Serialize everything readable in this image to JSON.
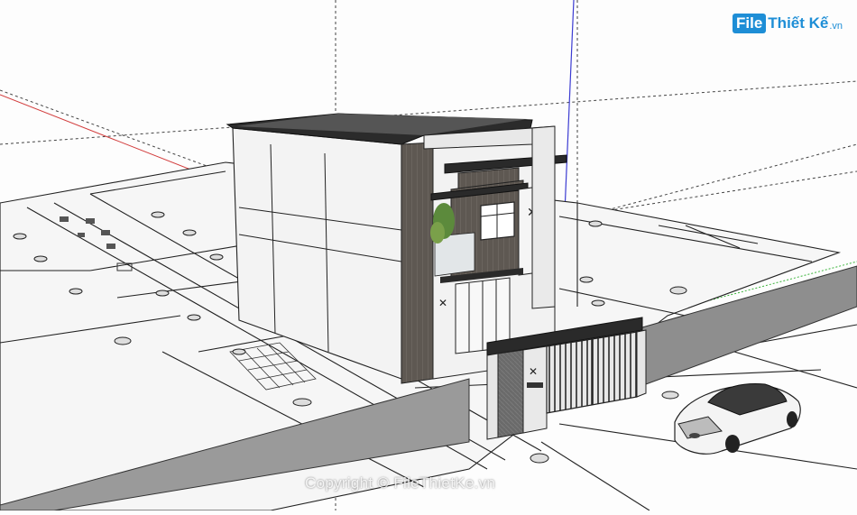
{
  "app": {
    "name": "SketchUp model viewport"
  },
  "logo": {
    "box_text": "File",
    "rest_text": "Thiết Kế",
    "tld_text": ".vn"
  },
  "watermark": {
    "text": "Copyright © FileThietKe.vn"
  },
  "colors": {
    "background": "#fdfdfd",
    "axis_red": "#d23c3c",
    "axis_blue": "#3c3cd2",
    "axis_green": "#3cb43c",
    "logo_blue": "#1e8ed6",
    "wall_dark": "#5c5650",
    "wall_white": "#f2f2f2",
    "roof": "#2b2b2b"
  },
  "scene": {
    "objects": [
      "site-plan",
      "two-story-house",
      "front-fence",
      "main-gate",
      "boundary-wall",
      "sedan-car",
      "potted-plant"
    ]
  }
}
